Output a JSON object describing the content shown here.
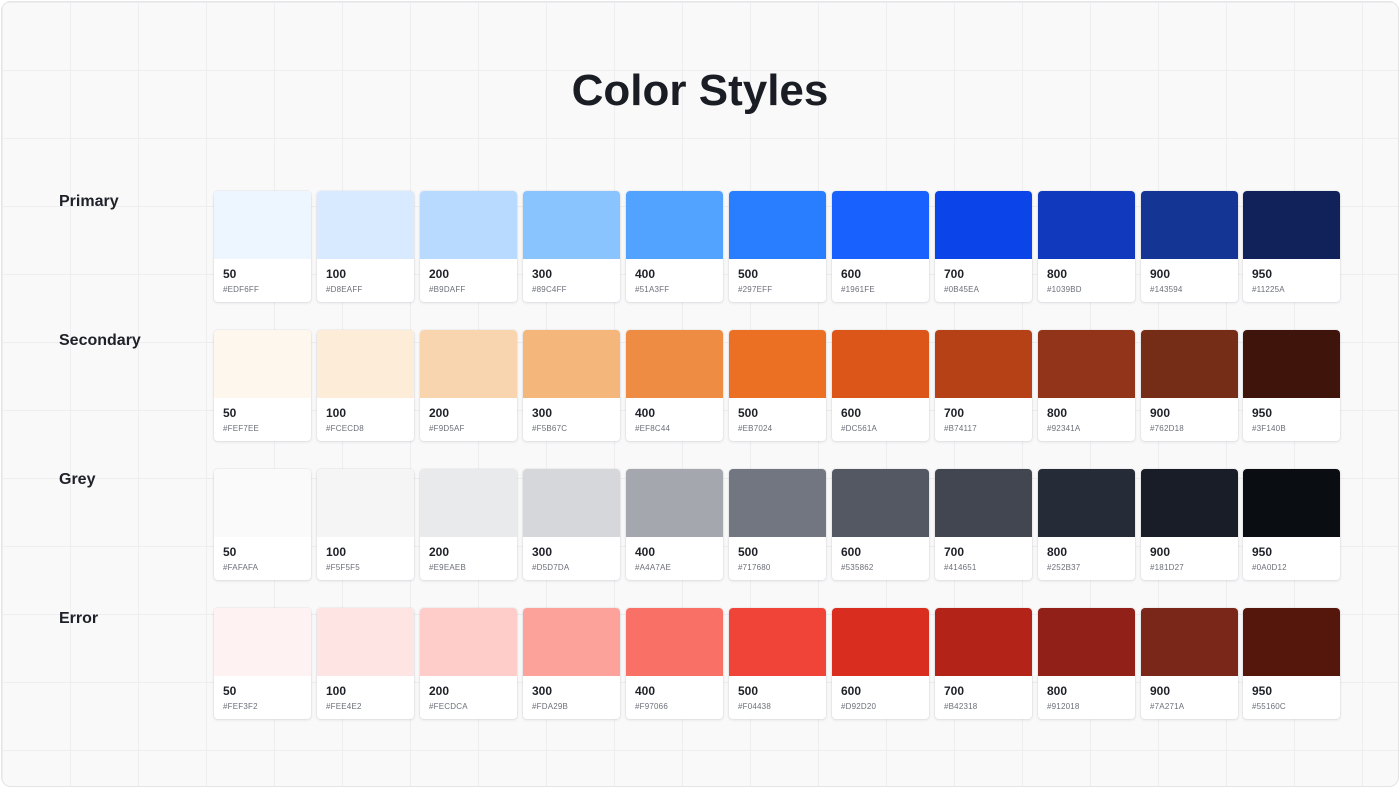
{
  "title": "Color Styles",
  "groups": [
    {
      "name": "Primary",
      "swatches": [
        {
          "shade": "50",
          "hex": "#EDF6FF"
        },
        {
          "shade": "100",
          "hex": "#D8EAFF"
        },
        {
          "shade": "200",
          "hex": "#B9DAFF"
        },
        {
          "shade": "300",
          "hex": "#89C4FF"
        },
        {
          "shade": "400",
          "hex": "#51A3FF"
        },
        {
          "shade": "500",
          "hex": "#297EFF"
        },
        {
          "shade": "600",
          "hex": "#1961FE"
        },
        {
          "shade": "700",
          "hex": "#0B45EA"
        },
        {
          "shade": "800",
          "hex": "#1039BD"
        },
        {
          "shade": "900",
          "hex": "#143594"
        },
        {
          "shade": "950",
          "hex": "#11225A"
        }
      ]
    },
    {
      "name": "Secondary",
      "swatches": [
        {
          "shade": "50",
          "hex": "#FEF7EE"
        },
        {
          "shade": "100",
          "hex": "#FCECD8"
        },
        {
          "shade": "200",
          "hex": "#F9D5AF"
        },
        {
          "shade": "300",
          "hex": "#F5B67C"
        },
        {
          "shade": "400",
          "hex": "#EF8C44"
        },
        {
          "shade": "500",
          "hex": "#EB7024"
        },
        {
          "shade": "600",
          "hex": "#DC561A"
        },
        {
          "shade": "700",
          "hex": "#B74117"
        },
        {
          "shade": "800",
          "hex": "#92341A"
        },
        {
          "shade": "900",
          "hex": "#762D18"
        },
        {
          "shade": "950",
          "hex": "#3F140B"
        }
      ]
    },
    {
      "name": "Grey",
      "swatches": [
        {
          "shade": "50",
          "hex": "#FAFAFA"
        },
        {
          "shade": "100",
          "hex": "#F5F5F5"
        },
        {
          "shade": "200",
          "hex": "#E9EAEB"
        },
        {
          "shade": "300",
          "hex": "#D5D7DA"
        },
        {
          "shade": "400",
          "hex": "#A4A7AE"
        },
        {
          "shade": "500",
          "hex": "#717680"
        },
        {
          "shade": "600",
          "hex": "#535862"
        },
        {
          "shade": "700",
          "hex": "#414651"
        },
        {
          "shade": "800",
          "hex": "#252B37"
        },
        {
          "shade": "900",
          "hex": "#181D27"
        },
        {
          "shade": "950",
          "hex": "#0A0D12"
        }
      ]
    },
    {
      "name": "Error",
      "swatches": [
        {
          "shade": "50",
          "hex": "#FEF3F2"
        },
        {
          "shade": "100",
          "hex": "#FEE4E2"
        },
        {
          "shade": "200",
          "hex": "#FECDCA"
        },
        {
          "shade": "300",
          "hex": "#FDA29B"
        },
        {
          "shade": "400",
          "hex": "#F97066"
        },
        {
          "shade": "500",
          "hex": "#F04438"
        },
        {
          "shade": "600",
          "hex": "#D92D20"
        },
        {
          "shade": "700",
          "hex": "#B42318"
        },
        {
          "shade": "800",
          "hex": "#912018"
        },
        {
          "shade": "900",
          "hex": "#7A271A"
        },
        {
          "shade": "950",
          "hex": "#55160C"
        }
      ]
    }
  ]
}
